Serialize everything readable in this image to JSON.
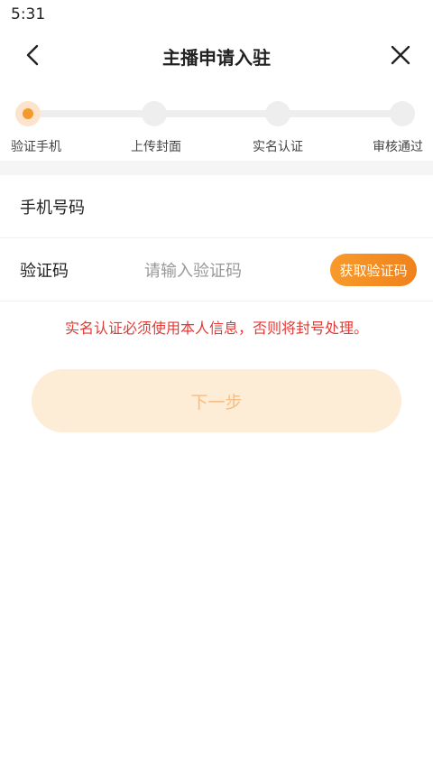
{
  "status_bar": {
    "time": "5:31"
  },
  "nav": {
    "title": "主播申请入驻",
    "back_icon": "chevron-left-icon",
    "close_icon": "close-icon"
  },
  "stepper": {
    "active_index": 0,
    "accent_color": "#f49a2c",
    "steps": [
      {
        "label": "验证手机"
      },
      {
        "label": "上传封面"
      },
      {
        "label": "实名认证"
      },
      {
        "label": "审核通过"
      }
    ]
  },
  "form": {
    "phone": {
      "label": "手机号码",
      "value": "",
      "placeholder": ""
    },
    "code": {
      "label": "验证码",
      "value": "",
      "placeholder": "请输入验证码",
      "button_label": "获取验证码"
    }
  },
  "warning_text": "实名认证必须使用本人信息，否则将封号处理。",
  "next_button": {
    "label": "下一步",
    "enabled": false
  }
}
